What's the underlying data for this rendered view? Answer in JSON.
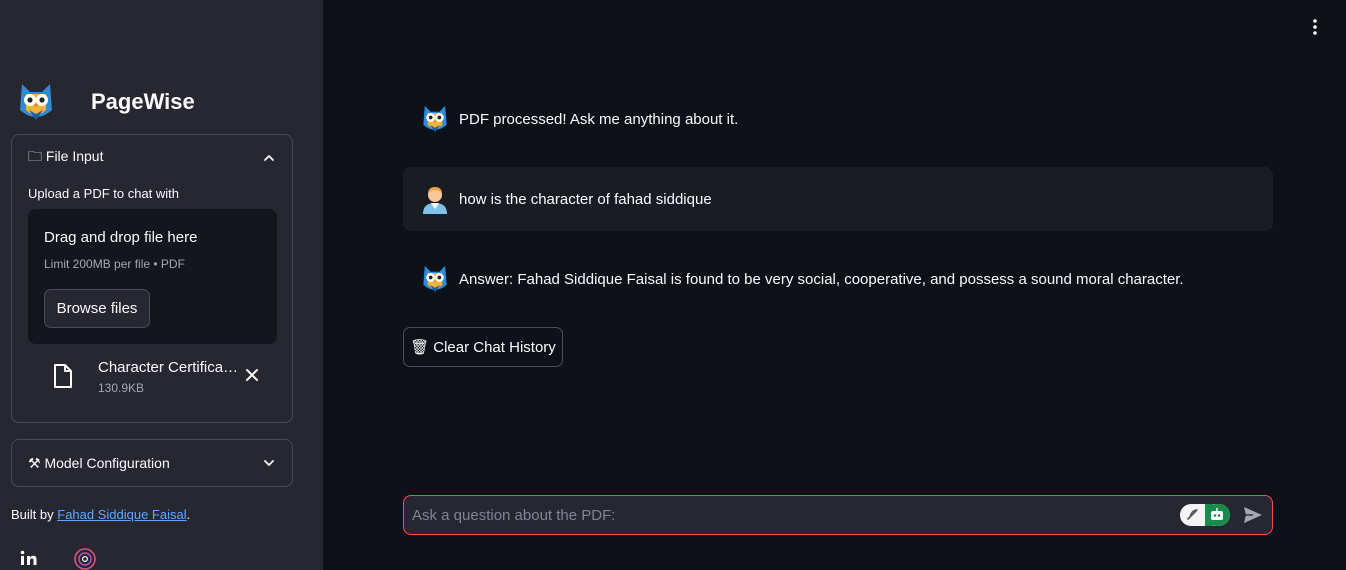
{
  "sidebar": {
    "brand": {
      "title": "PageWise",
      "logo_icon": "owl-logo-icon"
    },
    "file_input": {
      "header": "🗀 File Input",
      "upload_label": "Upload a PDF to chat with",
      "dropzone_title": "Drag and drop file here",
      "dropzone_limit": "Limit 200MB per file • PDF",
      "browse_label": "Browse files",
      "file": {
        "name": "Character Certificate.pdf",
        "size": "130.9KB"
      }
    },
    "model_config": {
      "header": "⚒ Model Configuration"
    },
    "built_by": {
      "prefix": "Built by ",
      "link": "Fahad Siddique Faisal",
      "suffix": "."
    },
    "social": [
      "linkedin-icon",
      "threads-icon"
    ]
  },
  "chat": {
    "messages": [
      {
        "role": "assistant",
        "text": "PDF processed! Ask me anything about it."
      },
      {
        "role": "user",
        "text": "how is the character of fahad siddique"
      },
      {
        "role": "assistant",
        "text": "Answer: Fahad Siddique Faisal is found to be very social, cooperative, and possess a sound moral character."
      }
    ],
    "clear_label": "Clear Chat History",
    "clear_icon": "🗑",
    "input": {
      "placeholder": "Ask a question about the PDF:",
      "value": ""
    }
  },
  "colors": {
    "accent": "#ff4b4b",
    "link": "#5fa8ff",
    "sidebar_bg": "#262730",
    "main_bg": "#0e1117"
  }
}
